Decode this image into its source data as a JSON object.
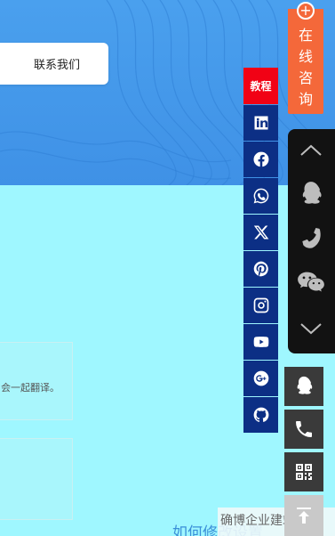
{
  "banner": {
    "contact_label": "联系我们"
  },
  "content": {
    "card1_text": "会一起翻译。",
    "bottom_link": "如何修改设置",
    "corner_text": "确博企业建站系统"
  },
  "social": {
    "tutorial_label": "教程",
    "items": [
      "linkedin-icon",
      "facebook-icon",
      "whatsapp-icon",
      "x-icon",
      "pinterest-icon",
      "instagram-icon",
      "youtube-icon",
      "google-plus-icon",
      "github-icon"
    ],
    "bg_color": "#0c2f85",
    "tutorial_color": "#f10215"
  },
  "consult": {
    "chars": [
      "在",
      "线",
      "咨",
      "询"
    ],
    "color": "#f4683a"
  },
  "dark_panel": {
    "items": [
      "chevron-up-icon",
      "qq-icon",
      "phone-icon",
      "wechat-icon",
      "chevron-down-icon"
    ]
  },
  "square_buttons": [
    "qq-icon",
    "phone-icon",
    "qrcode-icon",
    "back-to-top-icon"
  ]
}
